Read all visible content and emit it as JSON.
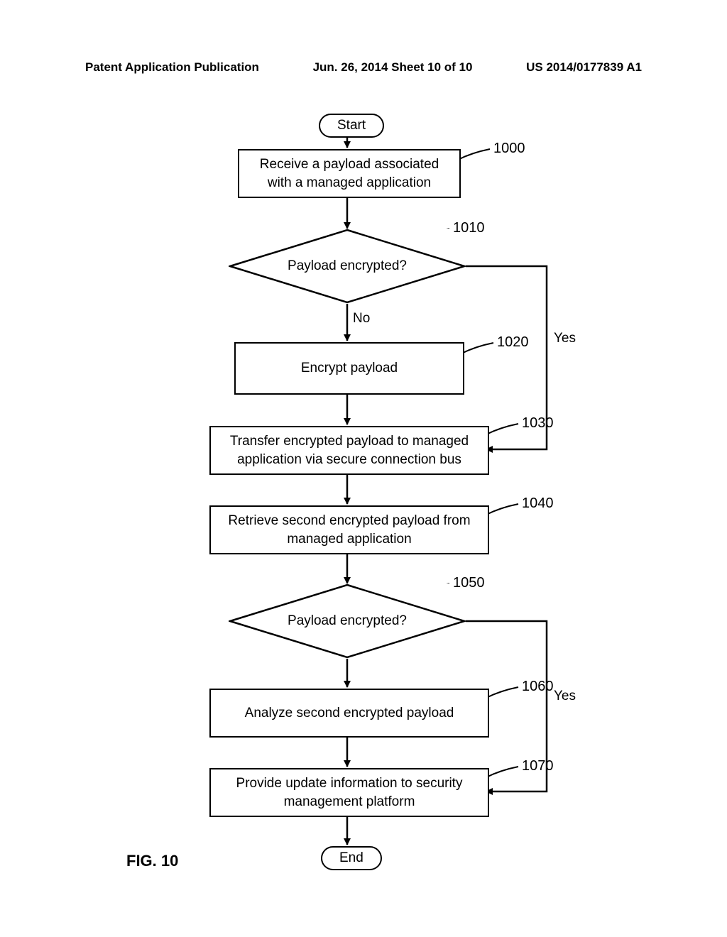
{
  "header": {
    "left": "Patent Application Publication",
    "center": "Jun. 26, 2014  Sheet 10 of 10",
    "right": "US 2014/0177839 A1"
  },
  "figure_label": "FIG. 10",
  "nodes": {
    "start": "Start",
    "end": "End",
    "n1000": {
      "l1": "Receive a payload associated",
      "l2": "with a managed application"
    },
    "n1010": "Payload encrypted?",
    "n1020": "Encrypt payload",
    "n1030": {
      "l1": "Transfer encrypted payload to managed",
      "l2": "application via secure connection bus"
    },
    "n1040": {
      "l1": "Retrieve second encrypted payload from",
      "l2": "managed application"
    },
    "n1050": "Payload encrypted?",
    "n1060": "Analyze second encrypted payload",
    "n1070": {
      "l1": "Provide update information to security",
      "l2": "management platform"
    }
  },
  "refs": {
    "r1000": "1000",
    "r1010": "1010",
    "r1020": "1020",
    "r1030": "1030",
    "r1040": "1040",
    "r1050": "1050",
    "r1060": "1060",
    "r1070": "1070"
  },
  "edges": {
    "no": "No",
    "yes1": "Yes",
    "yes2": "Yes"
  }
}
